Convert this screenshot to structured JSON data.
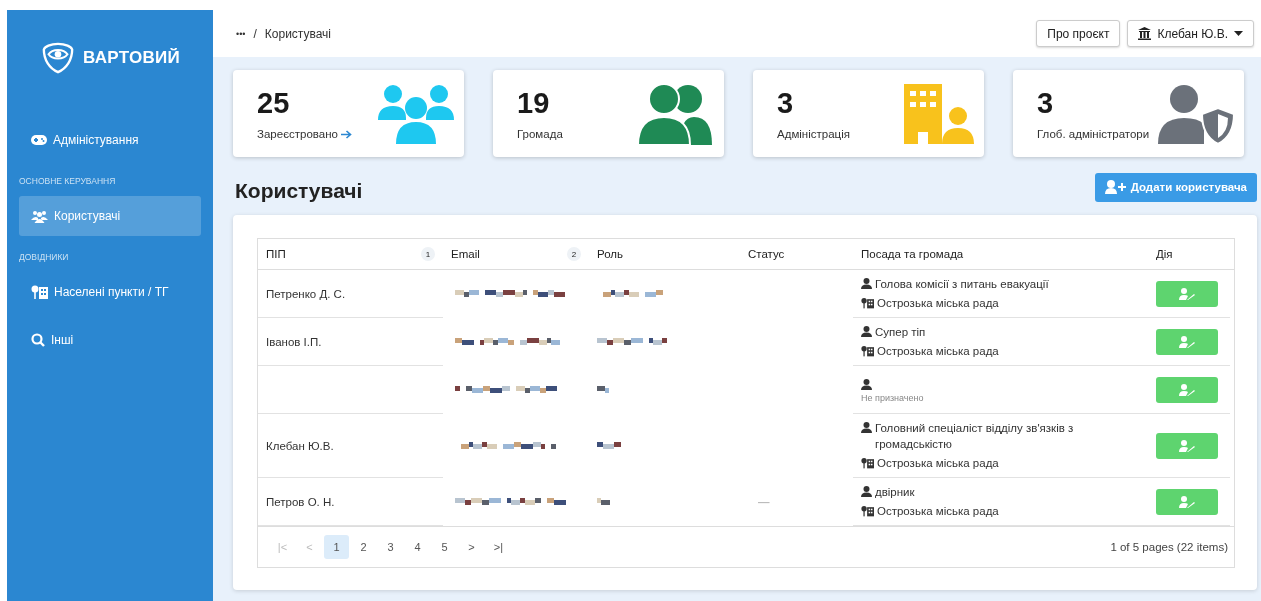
{
  "brand": "ВАРТОВИЙ",
  "sidebar": {
    "items": [
      {
        "kind": "item",
        "label": "Адміністування",
        "selected": false
      },
      {
        "kind": "section",
        "label": "ОСНОВНЕ КЕРУВАННЯ"
      },
      {
        "kind": "item",
        "label": "Користувачі",
        "selected": true
      },
      {
        "kind": "section",
        "label": "ДОВІДНИКИ"
      },
      {
        "kind": "item",
        "label": "Населені пункти / ТГ",
        "selected": false
      },
      {
        "kind": "item",
        "label": "Інші",
        "selected": false
      }
    ]
  },
  "breadcrumb": {
    "ellipsis": "•••",
    "separator": "/",
    "current": "Користувачі"
  },
  "header_buttons": {
    "about": "Про проєкт",
    "user": "Клебан Ю.В."
  },
  "stats": [
    {
      "value": "25",
      "label": "Зареєстровано",
      "link": true,
      "color": "#1ec8f0"
    },
    {
      "value": "19",
      "label": "Громада",
      "link": false,
      "color": "#1f8a55"
    },
    {
      "value": "3",
      "label": "Адміністрація",
      "link": false,
      "color": "#f8c21c"
    },
    {
      "value": "3",
      "label": "Глоб. адміністратори",
      "link": false,
      "color": "#6b717a"
    }
  ],
  "page_title": "Користувачі",
  "add_button": "Додати користувача",
  "table": {
    "columns": [
      {
        "label": "ПІП",
        "sort": "1"
      },
      {
        "label": "Email",
        "sort": "2"
      },
      {
        "label": "Роль"
      },
      {
        "label": "Статус"
      },
      {
        "label": "Посада та громада"
      },
      {
        "label": "Дія"
      }
    ],
    "rows": [
      {
        "name": "Петренко Д. С.",
        "email_redacted": true,
        "role_redacted": true,
        "position": "Голова комісії з питань евакуації",
        "community": "Острозька міська рада",
        "unassigned": false
      },
      {
        "name": "Іванов І.П.",
        "email_redacted": true,
        "role_redacted": true,
        "position": "Супер тіп",
        "community": "Острозька міська рада",
        "unassigned": false
      },
      {
        "email_redacted": true,
        "role_redacted": true,
        "community": "Не призначено",
        "unassigned": true
      },
      {
        "name": "Клебан Ю.В.",
        "email_redacted": true,
        "role_redacted": true,
        "position": "Головний спеціаліст відділу зв'язків з громадськістю",
        "community": "Острозька міська рада",
        "unassigned": false
      },
      {
        "name": "Петров О. Н.",
        "email_redacted": true,
        "role_redacted": true,
        "status": "—",
        "position": "двірник",
        "community": "Острозька міська рада",
        "unassigned": false
      }
    ]
  },
  "pagination": {
    "first": "|<",
    "prev": "<",
    "pages": [
      {
        "label": "1",
        "selected": true
      },
      {
        "label": "2",
        "selected": false
      },
      {
        "label": "3",
        "selected": false
      },
      {
        "label": "4",
        "selected": false
      },
      {
        "label": "5",
        "selected": false
      }
    ],
    "next": ">",
    "last": ">|",
    "summary": "1 of 5 pages (22 items)"
  }
}
